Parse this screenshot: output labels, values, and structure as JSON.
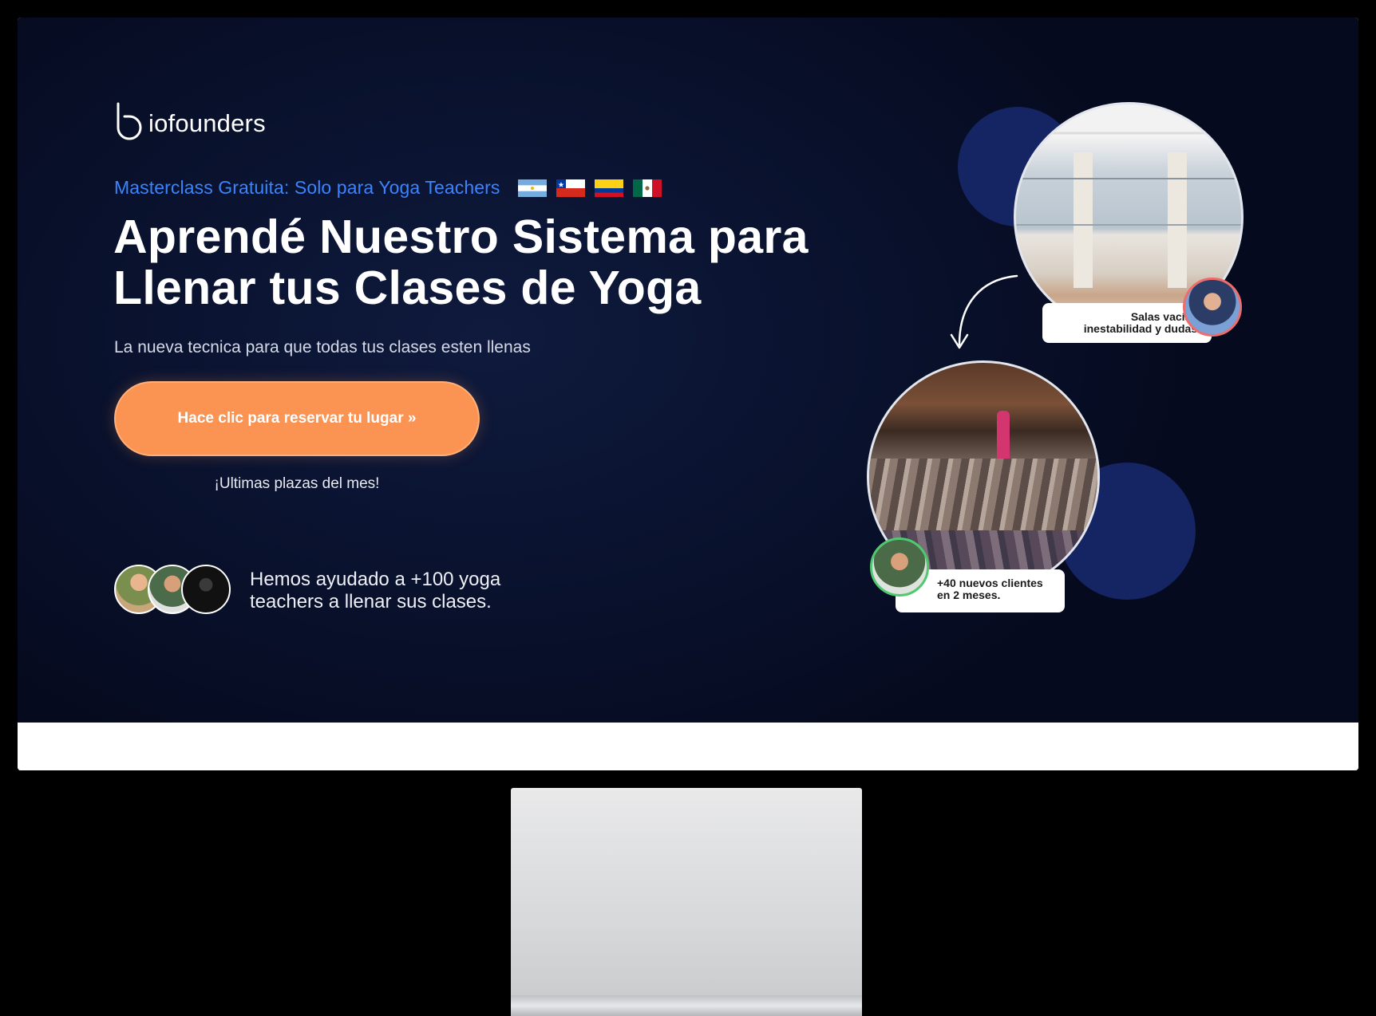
{
  "brand": {
    "logo_text": "iofounders",
    "logo_letter": "b"
  },
  "hero": {
    "kicker": "Masterclass Gratuita: Solo para Yoga Teachers",
    "headline_line1": "Aprendé Nuestro Sistema para",
    "headline_line2": "Llenar tus Clases de Yoga",
    "subhead": "La nueva tecnica para que todas tus clases esten llenas",
    "cta_label": "Hace clic para reservar tu lugar »",
    "scarcity": "¡Ultimas plazas del mes!"
  },
  "flags": [
    "argentina-flag",
    "chile-flag",
    "colombia-flag",
    "mexico-flag"
  ],
  "social_proof": {
    "line1": "Hemos ayudado a +100 yoga",
    "line2": "teachers a llenar sus clases."
  },
  "visual": {
    "before_caption_line1": "Salas vacías,",
    "before_caption_line2": "inestabilidad y dudas.",
    "after_caption_line1": "+40 nuevos clientes",
    "after_caption_line2": "en 2 meses."
  },
  "colors": {
    "background": "#0a1330",
    "accent_blue": "#3a84ff",
    "cta_orange": "#fb9353",
    "deco_navy": "#152463"
  }
}
